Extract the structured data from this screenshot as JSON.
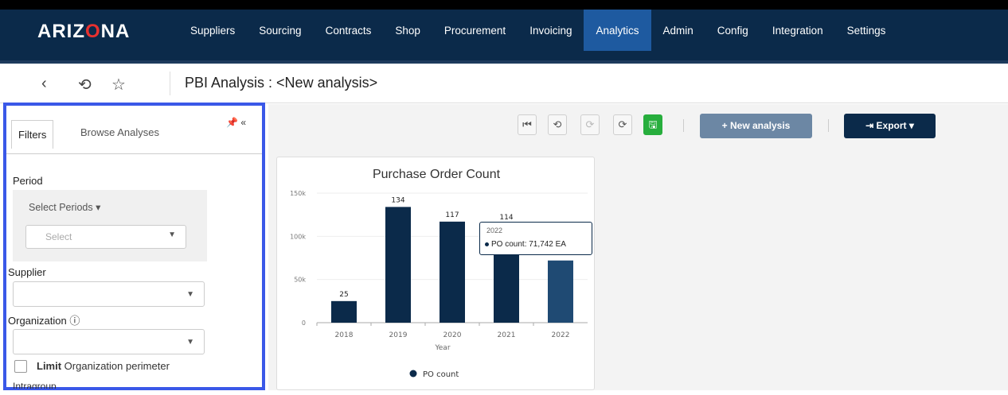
{
  "app": {
    "logo_prefix": "ARIZ",
    "logo_o": "O",
    "logo_suffix": "NA"
  },
  "nav": [
    {
      "label": "Suppliers"
    },
    {
      "label": "Sourcing"
    },
    {
      "label": "Contracts"
    },
    {
      "label": "Shop"
    },
    {
      "label": "Procurement"
    },
    {
      "label": "Invoicing"
    },
    {
      "label": "Analytics",
      "active": true
    },
    {
      "label": "Admin"
    },
    {
      "label": "Config"
    },
    {
      "label": "Integration"
    },
    {
      "label": "Settings"
    }
  ],
  "subbar": {
    "title": "PBI Analysis : <New analysis>",
    "back_icon": "‹",
    "history_icon": "⟲",
    "star_icon": "☆"
  },
  "filters": {
    "tab_filters": "Filters",
    "tab_browse": "Browse Analyses",
    "pin_icon": "📌 «",
    "period_label": "Period",
    "select_periods": "Select Periods ▾",
    "select_placeholder": "Select",
    "supplier_label": "Supplier",
    "organization_label": "Organization ⓘ",
    "limit_label_bold": "Limit",
    "limit_label_rest": " Organization perimeter",
    "partial_label": "Intragroup"
  },
  "toolbar": {
    "first_icon": "⏮",
    "undo_icon": "⟲",
    "redo_icon": "⟳",
    "refresh_icon": "⟳",
    "save_icon": "🖫",
    "new_analysis": "+ New analysis",
    "export": "⇥ Export ▾"
  },
  "tooltip": {
    "year": "2022",
    "text": "PO count: 71,742 EA"
  },
  "chart_data": {
    "type": "bar",
    "title": "Purchase Order Count",
    "xlabel": "Year",
    "ylabel": "",
    "categories": [
      "2018",
      "2019",
      "2020",
      "2021",
      "2022"
    ],
    "series": [
      {
        "name": "PO count",
        "values": [
          25,
          134,
          117,
          114,
          72
        ]
      }
    ],
    "data_labels": [
      "25",
      "134",
      "117",
      "114",
      ""
    ],
    "yticks": [
      "0",
      "50k",
      "100k",
      "150k"
    ],
    "ylim": [
      0,
      150
    ],
    "color": "#0b2a4a",
    "highlight_color": "#1f4a73",
    "legend": "bottom"
  }
}
